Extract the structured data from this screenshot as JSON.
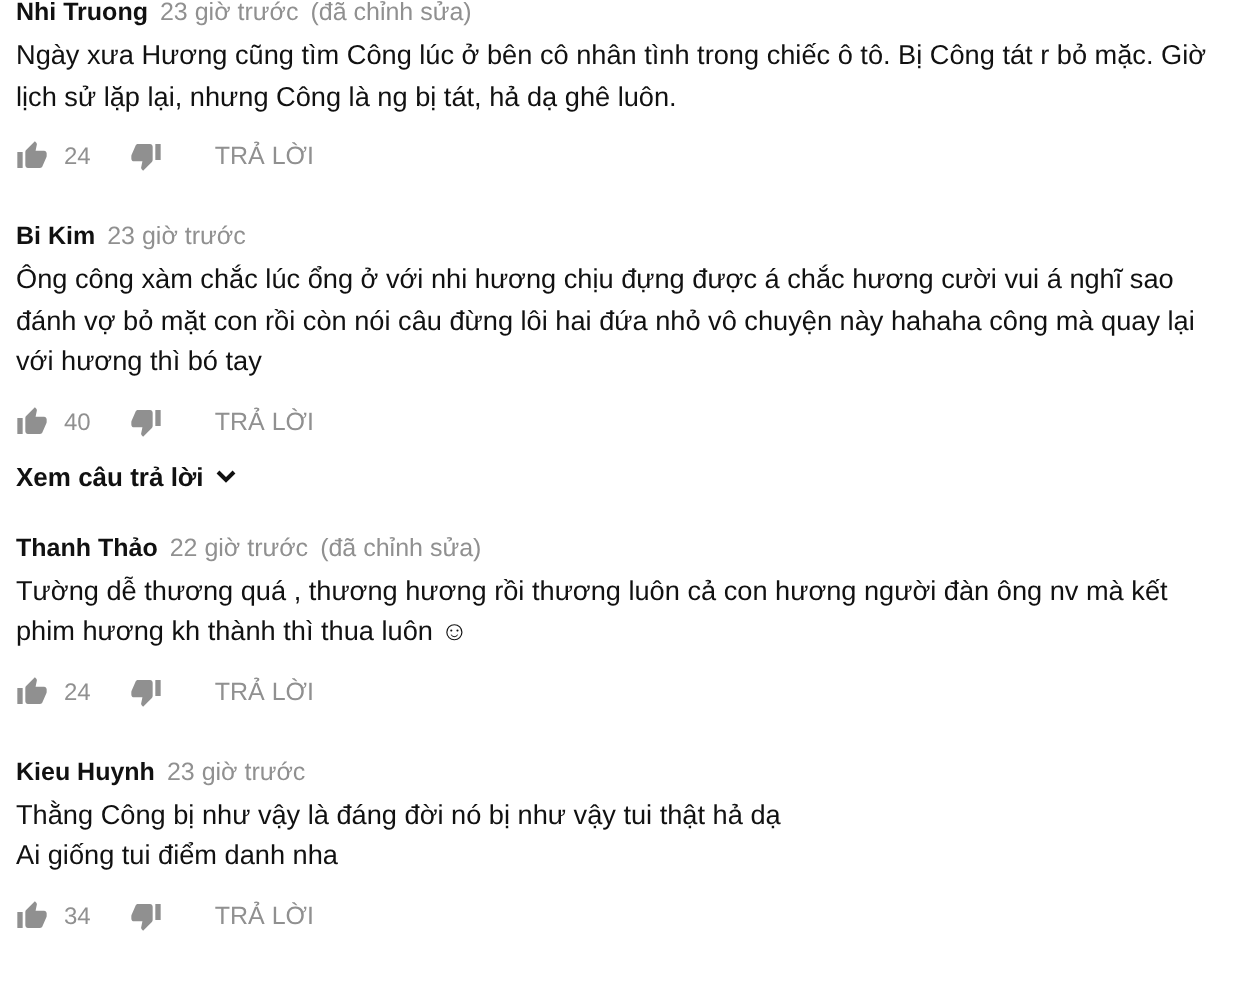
{
  "comments": [
    {
      "author": "Nhi Truong",
      "time": "23 giờ trước",
      "edited_note": "(đã chỉnh sửa)",
      "body_lines": [
        "Ngày xưa Hương cũng tìm Công lúc ở bên cô nhân tình trong chiếc ô tô. Bị Công tát r bỏ mặc. Giờ",
        "lịch sử lặp lại, nhưng Công là ng bị tát, hả dạ ghê luôn."
      ],
      "likes": "24",
      "reply_label": "TRẢ LỜI"
    },
    {
      "author": "Bi Kim",
      "time": "23 giờ trước",
      "body_lines": [
        "Ông công xàm chắc lúc ổng ở với nhi hương chịu đựng được á chắc hương cười vui á nghĩ sao",
        "đánh vợ bỏ mặt con rồi còn nói câu đừng lôi hai đứa nhỏ vô chuyện này hahaha công mà quay lại",
        "với hương thì bó tay"
      ],
      "likes": "40",
      "reply_label": "TRẢ LỜI",
      "view_replies": "Xem câu trả lời"
    },
    {
      "author": "Thanh Thảo",
      "time": "22 giờ trước",
      "edited_note": "(đã chỉnh sửa)",
      "body_lines": [
        "Tường dễ thương quá , thương hương rồi thương luôn cả con hương người đàn ông nv mà kết",
        "phim hương kh thành thì thua luôn ☺"
      ],
      "likes": "24",
      "reply_label": "TRẢ LỜI"
    },
    {
      "author": "Kieu Huynh",
      "time": "23 giờ trước",
      "body_lines": [
        "Thằng Công bị như vậy là đáng đời nó bị như vậy tui thật hả dạ",
        "Ai giống tui điểm danh nha"
      ],
      "likes": "34",
      "reply_label": "TRẢ LỜI"
    }
  ]
}
